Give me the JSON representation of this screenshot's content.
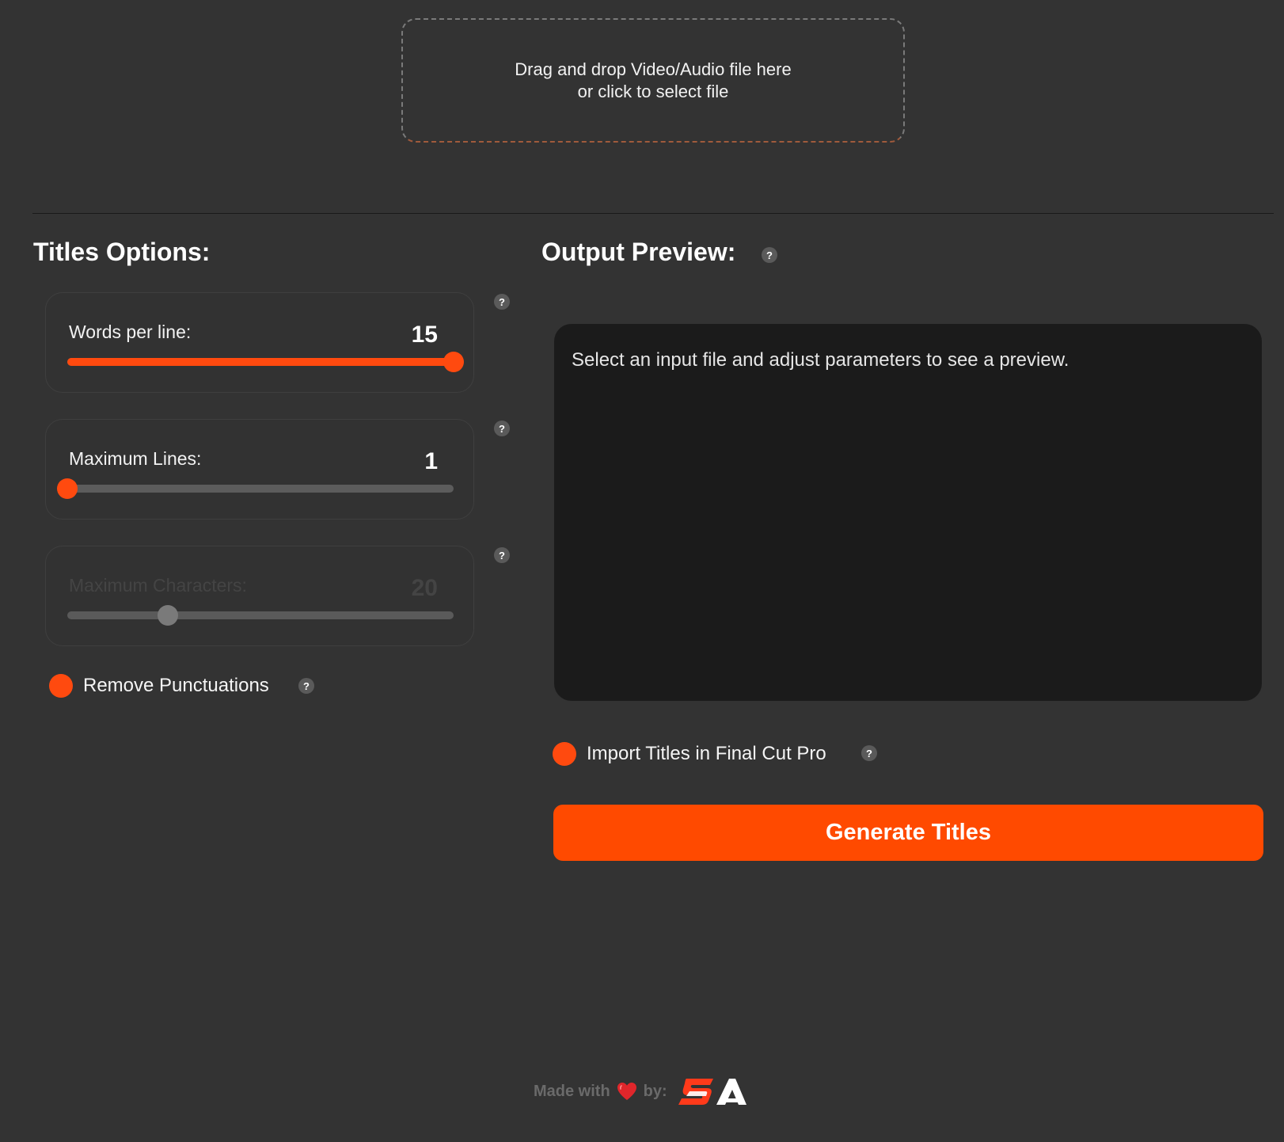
{
  "dropzone": {
    "line1": "Drag and drop Video/Audio file here",
    "line2": "or click to select file"
  },
  "titles_options": {
    "heading": "Titles Options:",
    "sliders": [
      {
        "label": "Words per line:",
        "value": "15",
        "fraction": 1.0,
        "enabled": true
      },
      {
        "label": "Maximum Lines:",
        "value": "1",
        "fraction": 0.0,
        "enabled": true
      },
      {
        "label": "Maximum Characters:",
        "value": "20",
        "fraction": 0.26,
        "enabled": false
      }
    ],
    "remove_punctuations": {
      "label": "Remove Punctuations",
      "enabled": true
    }
  },
  "output_preview": {
    "heading": "Output Preview:",
    "placeholder": "Select an input file and adjust parameters to see a preview."
  },
  "import_fcp": {
    "label": "Import Titles in Final Cut Pro",
    "enabled": true
  },
  "generate_button": {
    "label": "Generate Titles"
  },
  "help": {
    "symbol": "?"
  },
  "footer": {
    "made_with": "Made with",
    "by": "by:",
    "heart_icon": "heart-icon",
    "logo_text": "SA"
  },
  "colors": {
    "background": "#333333",
    "accent": "#ff4a0f",
    "preview_bg": "#1b1b1b",
    "muted": "#6a6a6a"
  }
}
